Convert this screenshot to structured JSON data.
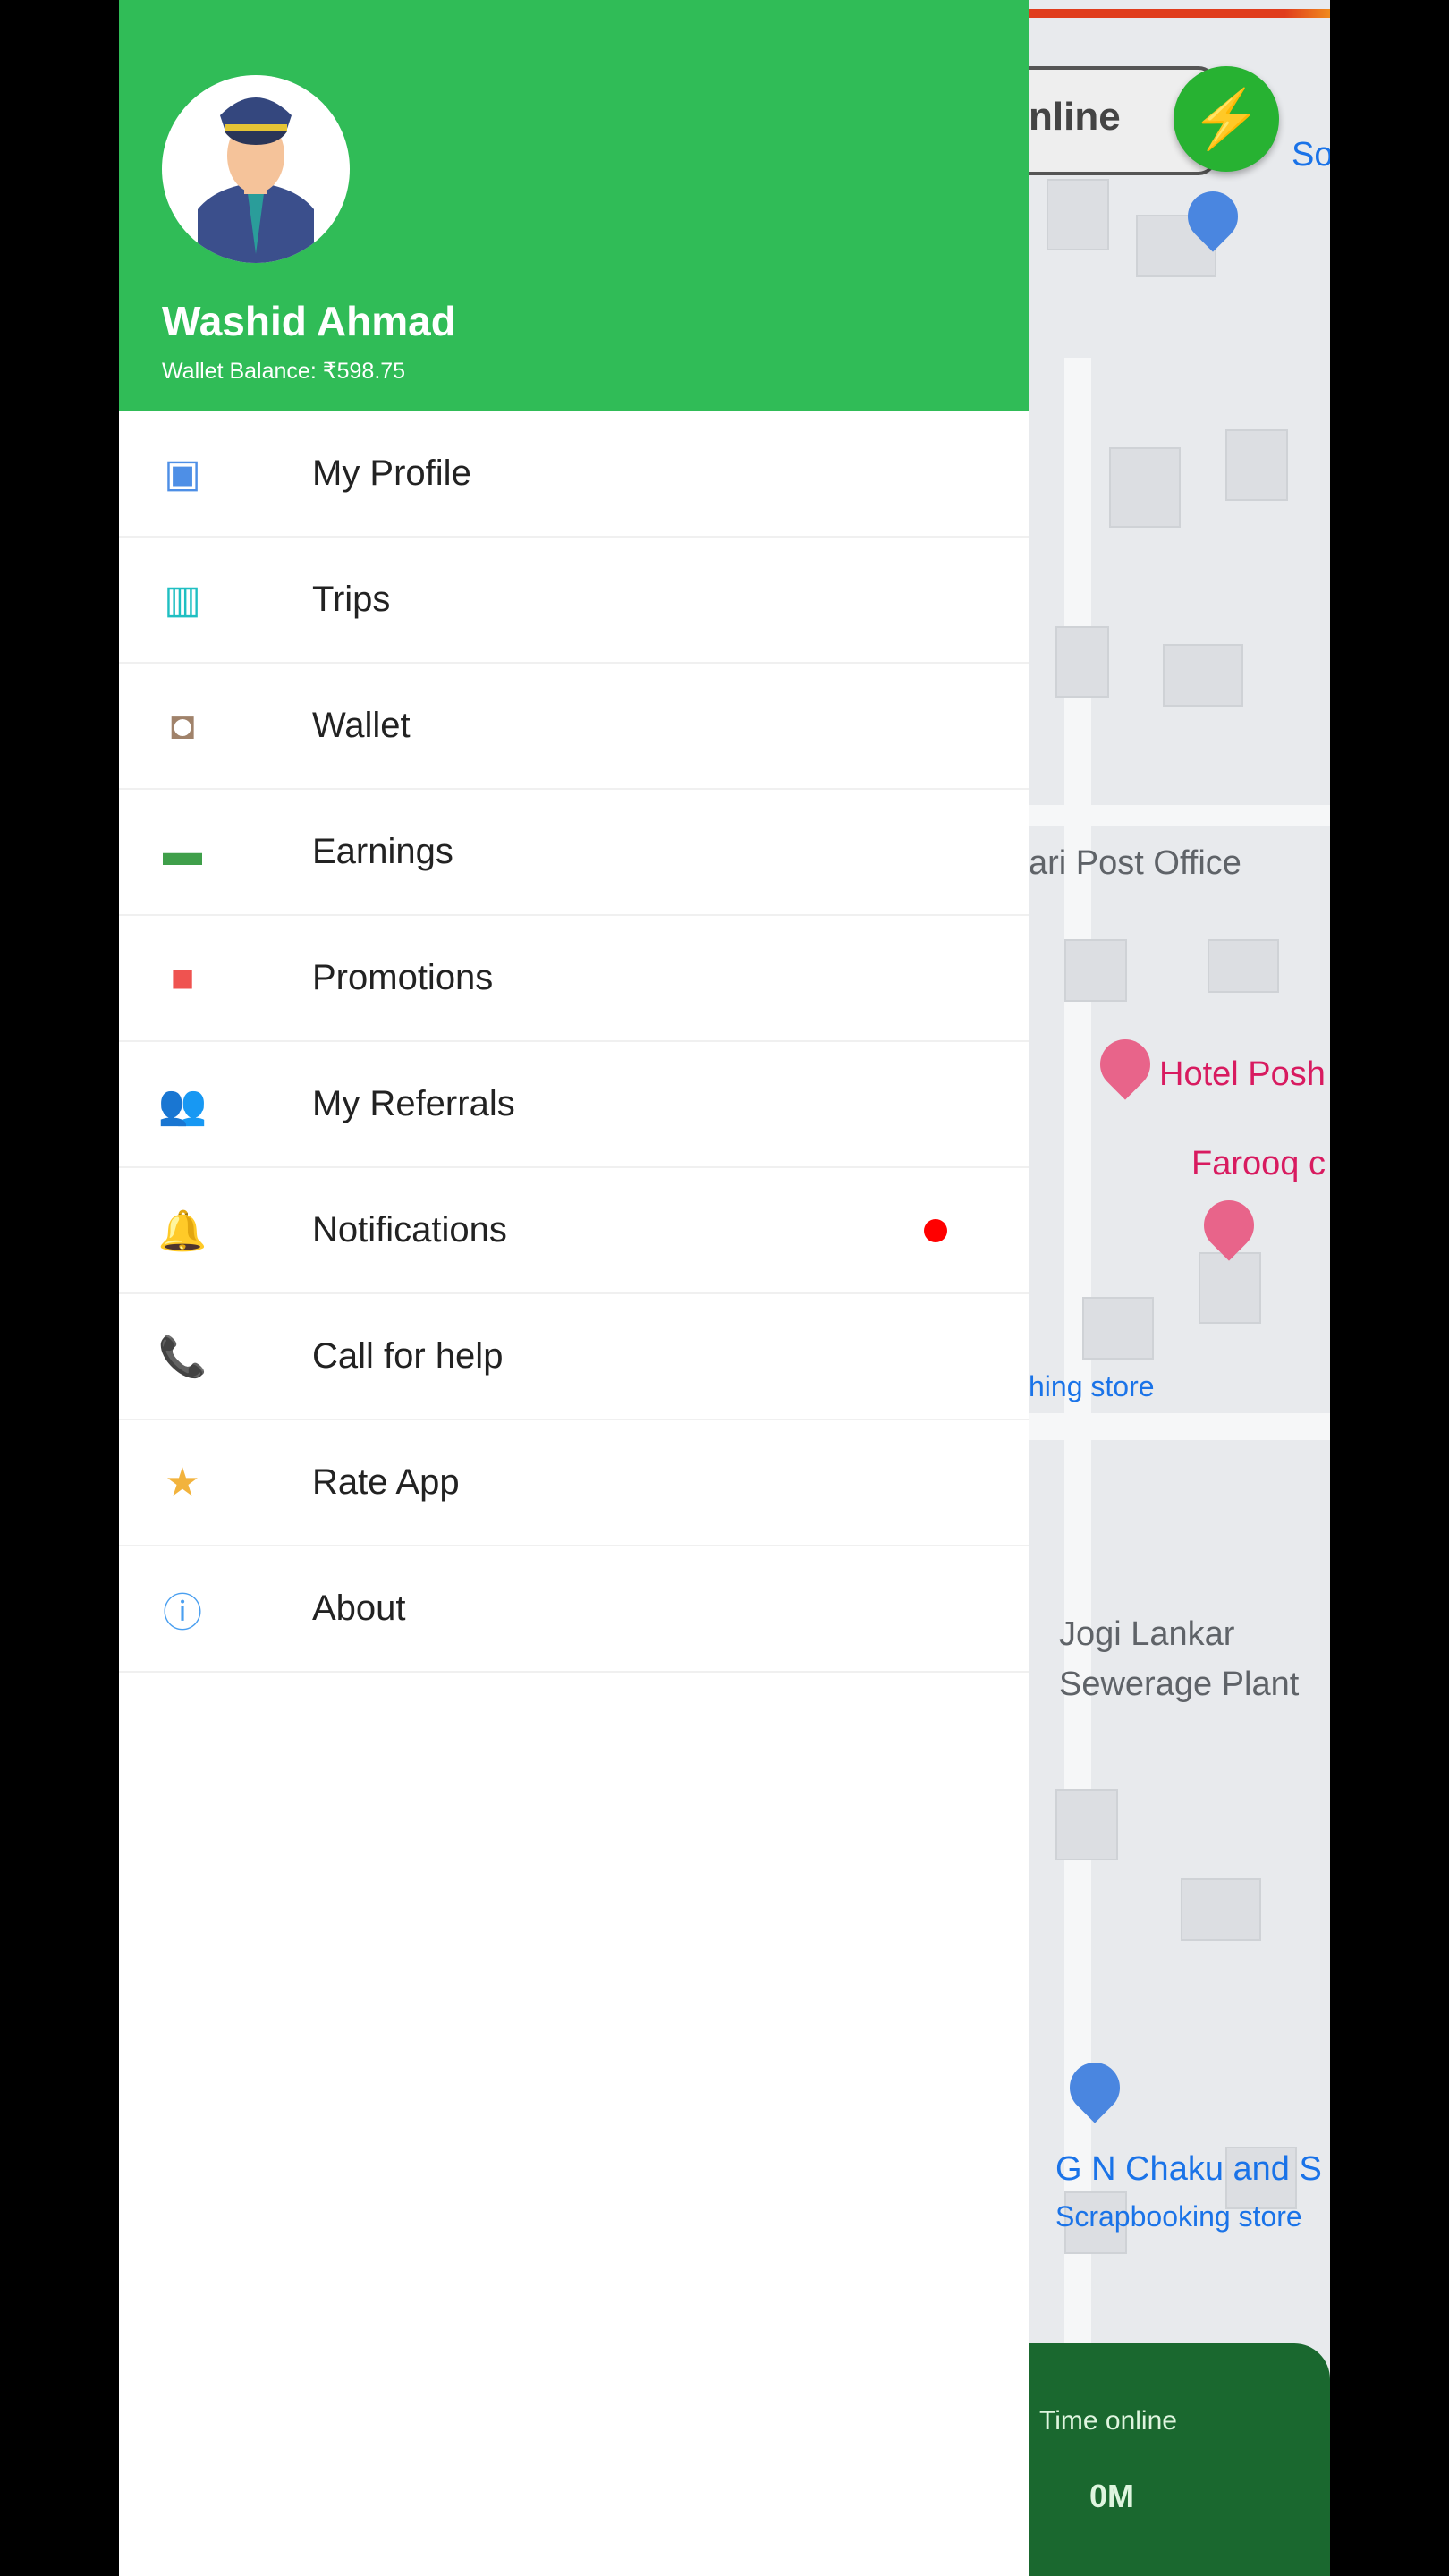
{
  "drawer": {
    "user_name": "Washid Ahmad",
    "wallet_balance": "Wallet Balance: ₹598.75",
    "header_color": "#30bc57",
    "items": [
      {
        "label": "My Profile",
        "icon": "contact-book-icon",
        "color": "#4e8fe6"
      },
      {
        "label": "Trips",
        "icon": "map-icon",
        "color": "#1fbfc2"
      },
      {
        "label": "Wallet",
        "icon": "wallet-icon",
        "color": "#a0826a"
      },
      {
        "label": "Earnings",
        "icon": "money-bill-icon",
        "color": "#3f9f4a"
      },
      {
        "label": "Promotions",
        "icon": "gift-icon",
        "color": "#ef5350"
      },
      {
        "label": "My Referrals",
        "icon": "users-icon",
        "color": "#5c6f80"
      },
      {
        "label": "Notifications",
        "icon": "bell-icon",
        "color": "#b57ad6",
        "badge": true
      },
      {
        "label": "Call for help",
        "icon": "phone-icon",
        "color": "#5fd35f"
      },
      {
        "label": "Rate App",
        "icon": "star-icon",
        "color": "#f2b33d"
      },
      {
        "label": "About",
        "icon": "info-icon",
        "color": "#4a9ff0"
      }
    ]
  },
  "map": {
    "status_text": "nline",
    "labels": [
      "Soba",
      "ari Post Office",
      "Hotel Posh",
      "Farooq c",
      "hing store",
      "Jogi Lankar",
      "Sewerage Plant",
      "G N Chaku and S",
      "Scrapbooking store"
    ],
    "time_online_label": "Time online",
    "time_online_value": "0M"
  }
}
